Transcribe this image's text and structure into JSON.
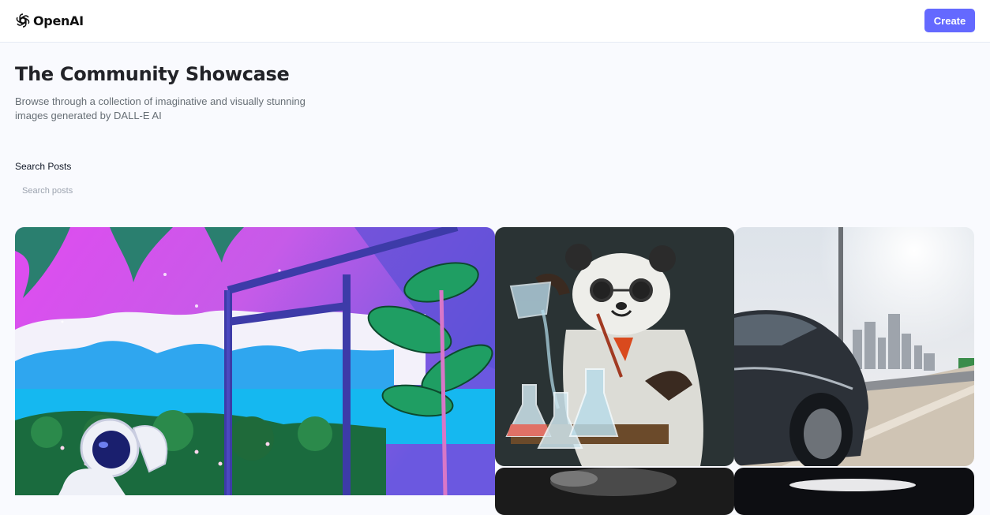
{
  "header": {
    "logo_text": "OpenAI",
    "logo_icon": "openai-logo-icon",
    "create_label": "Create"
  },
  "hero": {
    "title": "The Community Showcase",
    "subtitle": "Browse through a collection of imaginative and visually stunning images generated by DALL-E AI"
  },
  "search": {
    "label": "Search Posts",
    "placeholder": "Search posts",
    "value": ""
  },
  "gallery": {
    "cards": [
      {
        "subject": "astronaut-vaporwave-image"
      },
      {
        "subject": "panda-scientist-image"
      },
      {
        "subject": "car-highway-city-image"
      },
      {
        "subject": "dark-image"
      },
      {
        "subject": "dark-image"
      }
    ]
  },
  "colors": {
    "accent": "#6469ff",
    "background": "#f9fafe",
    "title": "#222328",
    "subtitle": "#666e75"
  }
}
